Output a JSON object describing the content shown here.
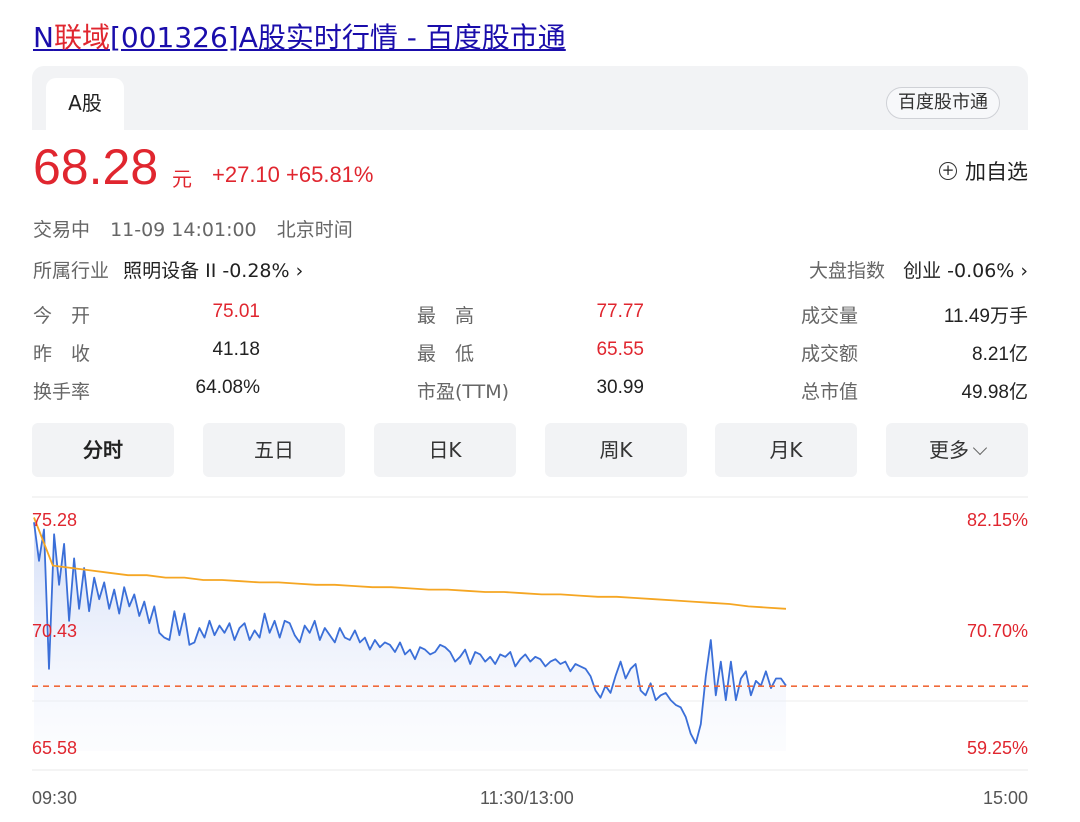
{
  "page_title": {
    "prefix": "N",
    "highlight": "联域",
    "suffix": "[001326]A股实时行情 - 百度股市通"
  },
  "tabs": {
    "a_share": "A股",
    "brand": "百度股市通"
  },
  "quote": {
    "price": "68.28",
    "unit": "元",
    "change": "+27.10 +65.81%",
    "add_watch_label": "加自选"
  },
  "status": {
    "state": "交易中",
    "time": "11-09 14:01:00",
    "zone": "北京时间"
  },
  "industry": {
    "label": "所属行业",
    "value": "照明设备 II -0.28% ›"
  },
  "market_index": {
    "label": "大盘指数",
    "value": "创业 -0.06% ›"
  },
  "stats": [
    {
      "l1": "今　开",
      "v1": "75.01",
      "l2": "最　高",
      "v2": "77.77",
      "l3": "成交量",
      "v3": "11.49万手"
    },
    {
      "l1": "昨　收",
      "v1": "41.18",
      "l2": "最　低",
      "v2": "65.55",
      "l3": "成交额",
      "v3": "8.21亿"
    },
    {
      "l1": "换手率",
      "v1": "64.08%",
      "l2": "市盈(TTM)",
      "v2": "30.99",
      "l3": "总市值",
      "v3": "49.98亿"
    }
  ],
  "period_tabs": [
    "分时",
    "五日",
    "日K",
    "周K",
    "月K",
    "更多"
  ],
  "colors": {
    "up": "#e0262f",
    "link": "#1a0dab",
    "price_line": "#3b6fd8",
    "avg_line": "#f5a623",
    "ref_line": "#f06a3a"
  },
  "chart_data": {
    "type": "line",
    "y_left_ticks": [
      "75.28",
      "70.43",
      "65.58"
    ],
    "y_right_ticks": [
      "82.15%",
      "70.70%",
      "59.25%"
    ],
    "x_ticks": [
      "09:30",
      "11:30/13:00",
      "15:00"
    ],
    "ylim": [
      65.58,
      75.28
    ],
    "reference_price": 68.28,
    "series": [
      {
        "name": "",
        "values": [
          75.1,
          73.5,
          74.8,
          69.0,
          74.6,
          72.5,
          74.2,
          71.0,
          73.6,
          71.5,
          73.2,
          71.4,
          72.8,
          71.9,
          72.6,
          71.5,
          72.3,
          71.3,
          72.4,
          71.6,
          72.1,
          71.2,
          71.8,
          70.9,
          71.6,
          70.5,
          70.3,
          70.2,
          71.4,
          70.4,
          71.3,
          70.0,
          70.1,
          70.7,
          70.3,
          71.0,
          70.4,
          70.8,
          70.5,
          70.9,
          70.2,
          70.7,
          70.9,
          70.2,
          70.6,
          70.3,
          71.3,
          70.5,
          71.0,
          70.3,
          71.0,
          70.9,
          70.4,
          70.1,
          70.8,
          70.5,
          71.0,
          70.2,
          70.7,
          70.4,
          70.1,
          70.7,
          70.3,
          70.2,
          70.6,
          70.1,
          70.3,
          69.8,
          70.2,
          69.9,
          70.1,
          70.0,
          69.7,
          70.1,
          69.6,
          69.8,
          69.4,
          69.9,
          69.8,
          69.6,
          69.7,
          70.0,
          69.9,
          69.7,
          69.3,
          69.5,
          69.8,
          69.2,
          69.7,
          69.6,
          69.3,
          69.5,
          69.2,
          69.6,
          69.5,
          69.7,
          69.1,
          69.4,
          69.6,
          69.3,
          69.5,
          69.4,
          69.1,
          69.3,
          69.4,
          69.2,
          69.3,
          68.9,
          69.2,
          69.1,
          69.0,
          68.7,
          68.1,
          67.8,
          68.3,
          68.0,
          68.7,
          69.3,
          68.6,
          69.0,
          69.2,
          68.1,
          67.9,
          68.4,
          67.7,
          67.9,
          68.0,
          67.7,
          67.5,
          67.4,
          67.0,
          66.3,
          65.9,
          66.7,
          68.7,
          70.2,
          67.9,
          69.3,
          67.7,
          69.3,
          67.7,
          68.6,
          68.9,
          67.9,
          68.5,
          68.3,
          68.9,
          68.2,
          68.6,
          68.6,
          68.3
        ]
      },
      {
        "name": "",
        "values": [
          75.3,
          73.3,
          73.2,
          73.1,
          73.0,
          72.9,
          72.9,
          72.8,
          72.8,
          72.7,
          72.7,
          72.65,
          72.6,
          72.6,
          72.55,
          72.5,
          72.5,
          72.45,
          72.4,
          72.4,
          72.35,
          72.3,
          72.3,
          72.25,
          72.2,
          72.2,
          72.15,
          72.1,
          72.1,
          72.05,
          72.0,
          72.0,
          71.95,
          71.9,
          71.85,
          71.8,
          71.75,
          71.7,
          71.6,
          71.55,
          71.5
        ]
      }
    ]
  }
}
